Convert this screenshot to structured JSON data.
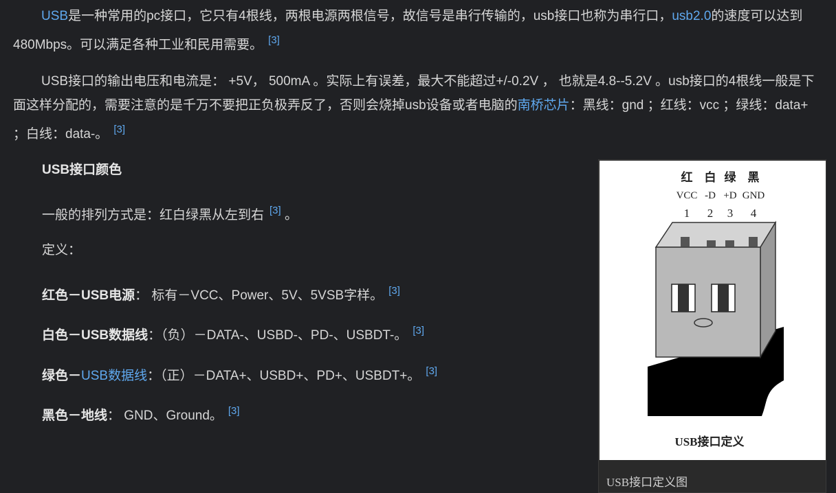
{
  "p1": {
    "link_usb": "USB",
    "t1": "是一种常用的pc接口，它只有4根线，两根电源两根信号，故信号是串行传输的，usb接口也称为串行口，",
    "link_usb2": "usb2.0",
    "t2": "的速度可以达到480Mbps。可以满足各种工业和民用需要。",
    "ref": "[3]"
  },
  "p2": {
    "t1": "USB接口的输出电压和电流是： +5V， 500mA 。实际上有误差，最大不能超过+/-0.2V ， 也就是4.8--5.2V 。usb接口的4根线一般是下面这样分配的，需要注意的是千万不要把正负极弄反了，否则会烧掉usb设备或者电脑的",
    "link_south": "南桥芯片",
    "t2": "：黑线：gnd ；红线：vcc ；绿线：data+ ；白线：data-。",
    "ref": "[3]"
  },
  "section_title": "USB接口颜色",
  "order_line": {
    "text": "一般的排列方式是：红白绿黑从左到右",
    "ref": "[3]",
    "tail": "。"
  },
  "definition_label": "定义：",
  "defs": {
    "red": {
      "label": "红色－USB电源",
      "text": "： 标有－VCC、Power、5V、5VSB字样。",
      "ref": "[3]"
    },
    "white": {
      "label": "白色－USB数据线",
      "text": "：（负）－DATA-、USBD-、PD-、USBDT-。",
      "ref": "[3]"
    },
    "green": {
      "label": "绿色－",
      "link": "USB数据线",
      "text": "：（正）－DATA+、USBD+、PD+、USBDT+。",
      "ref": "[3]"
    },
    "black": {
      "label": "黑色－地线",
      "text": "： GND、Ground。",
      "ref": "[3]"
    }
  },
  "figure": {
    "colors": [
      "红",
      "白",
      "绿",
      "黑"
    ],
    "signals": [
      "VCC",
      "-D",
      "+D",
      "GND"
    ],
    "pins": [
      "1",
      "2",
      "3",
      "4"
    ],
    "image_title": "USB接口定义",
    "caption": "USB接口定义图"
  }
}
